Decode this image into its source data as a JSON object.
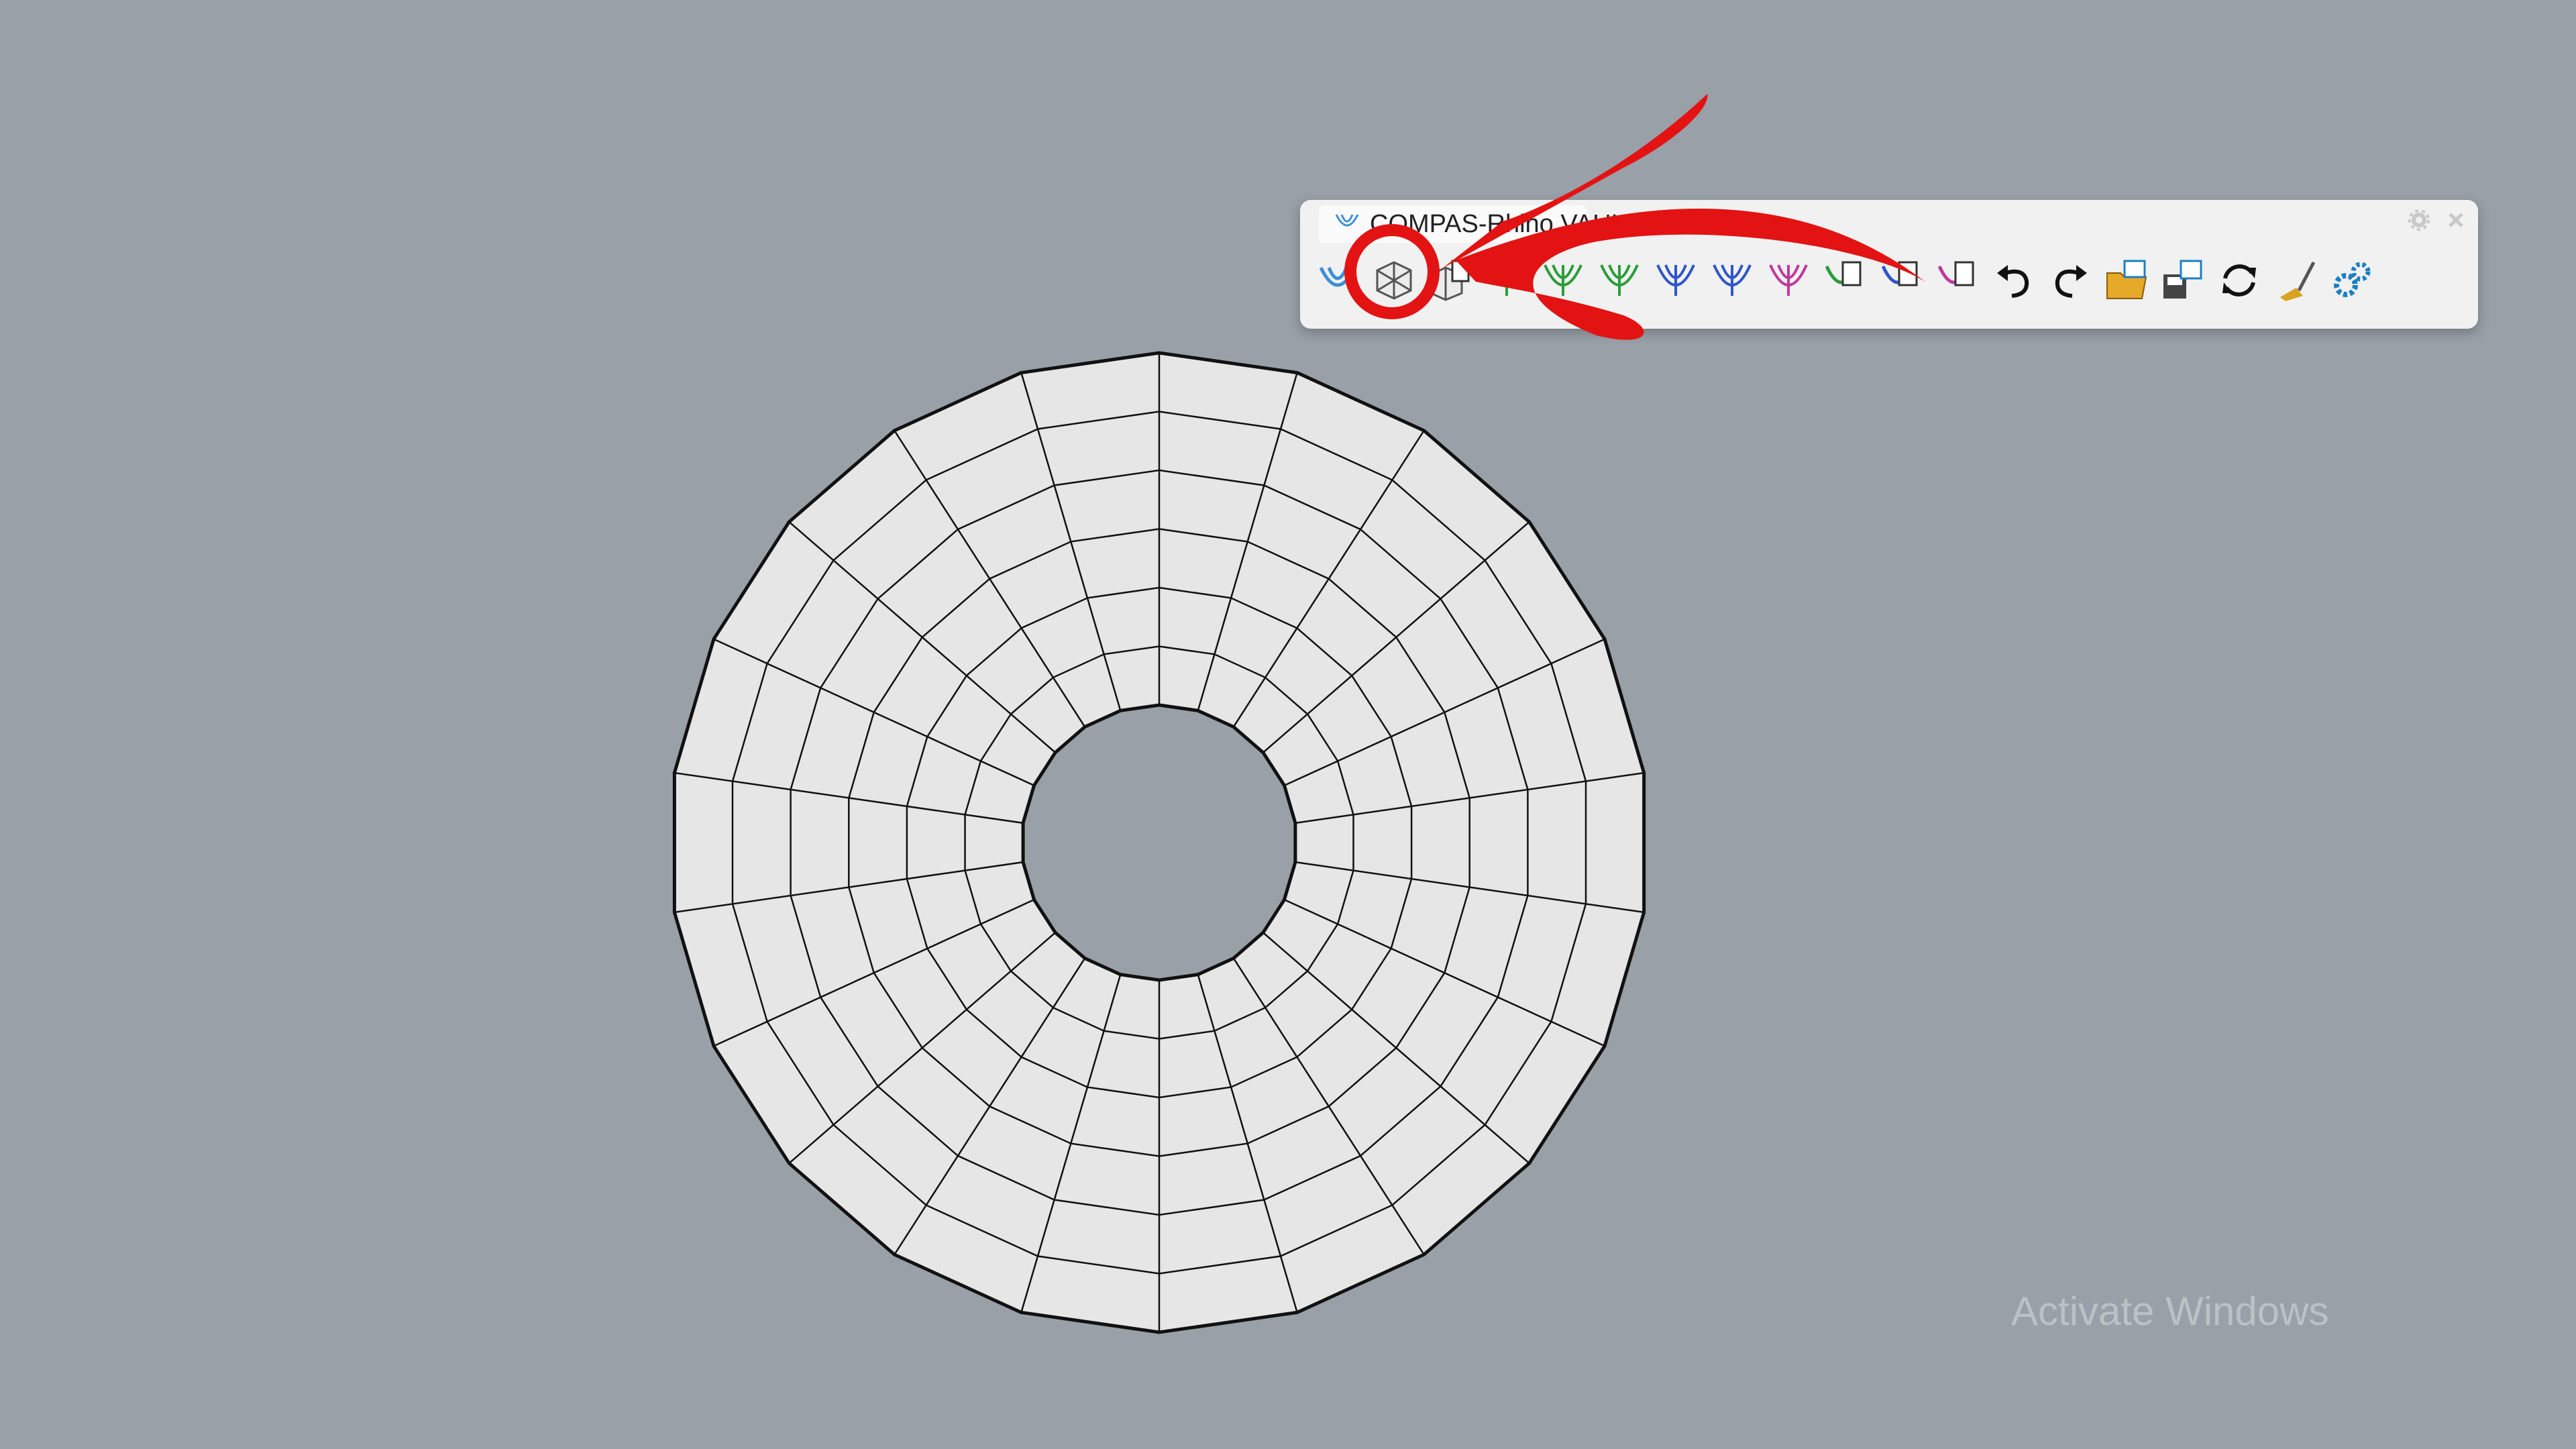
{
  "toolbar": {
    "title": "COMPAS-Rhino VAULT",
    "buttons": [
      {
        "name": "rv-init-button",
        "icon": "rv-logo-icon",
        "color": "#3b8fd6"
      },
      {
        "name": "form-from-surface-button",
        "icon": "mesh-box-icon",
        "color": "#555555"
      },
      {
        "name": "form-from-mesh-button",
        "icon": "mesh-box-doc-icon",
        "color": "#555555"
      },
      {
        "name": "form-modify-button",
        "icon": "form-modify-icon",
        "color": "#2a9d3a"
      },
      {
        "name": "form-boundary-button",
        "icon": "form-boundary-icon",
        "color": "#2a9d3a"
      },
      {
        "name": "form-green-button",
        "icon": "green-vault-icon",
        "color": "#2a9d3a"
      },
      {
        "name": "force-diagram-button",
        "icon": "blue-force-icon",
        "color": "#2f56c9"
      },
      {
        "name": "force-blue-button",
        "icon": "blue-force-icon-2",
        "color": "#2f56c9"
      },
      {
        "name": "thrust-diagram-button",
        "icon": "purple-thrust-icon",
        "color": "#c0399d"
      },
      {
        "name": "form-attributes-button",
        "icon": "green-doc-icon",
        "color": "#2a9d3a"
      },
      {
        "name": "force-attributes-button",
        "icon": "blue-doc-icon",
        "color": "#2f56c9"
      },
      {
        "name": "thrust-attributes-button",
        "icon": "purple-doc-icon",
        "color": "#c0399d"
      },
      {
        "name": "undo-button",
        "icon": "undo-icon",
        "color": "#111111"
      },
      {
        "name": "redo-button",
        "icon": "redo-icon",
        "color": "#111111"
      },
      {
        "name": "open-session-button",
        "icon": "folder-rv-icon",
        "color": "#e6a92a"
      },
      {
        "name": "save-session-button",
        "icon": "save-rv-icon",
        "color": "#444444"
      },
      {
        "name": "reload-button",
        "icon": "sync-icon",
        "color": "#111111"
      },
      {
        "name": "clear-button",
        "icon": "broom-icon",
        "color": "#d8a321"
      },
      {
        "name": "settings-button",
        "icon": "gear-cluster-icon",
        "color": "#1b7fc4"
      }
    ]
  },
  "mesh": {
    "type": "annulus-quad-mesh",
    "fill": "#e6e6e6",
    "stroke": "#111111",
    "segments": 22,
    "rings": 6
  },
  "annotation": {
    "color": "#e31313",
    "highlighted_button": "form-from-surface-button"
  },
  "watermark": {
    "text": "Activate Windows"
  }
}
